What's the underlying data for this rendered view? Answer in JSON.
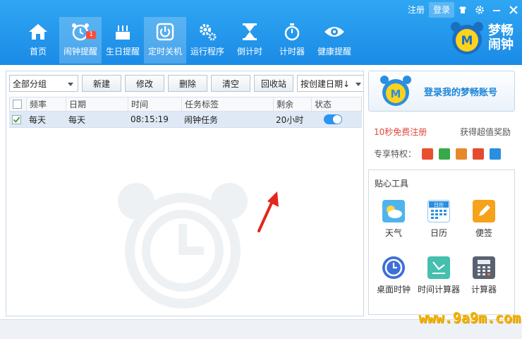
{
  "header": {
    "register": "注册",
    "login": "登录",
    "nav": [
      {
        "label": "首页",
        "icon": "home-icon"
      },
      {
        "label": "闹钟提醒",
        "icon": "alarm-clock-icon",
        "badge": "1"
      },
      {
        "label": "生日提醒",
        "icon": "birthday-cake-icon"
      },
      {
        "label": "定时关机",
        "icon": "power-icon"
      },
      {
        "label": "运行程序",
        "icon": "gear-icon"
      },
      {
        "label": "倒计时",
        "icon": "hourglass-icon"
      },
      {
        "label": "计时器",
        "icon": "stopwatch-icon"
      },
      {
        "label": "健康提醒",
        "icon": "eye-icon"
      }
    ],
    "brand": {
      "line1": "梦畅",
      "line2": "闹钟"
    }
  },
  "toolbar": {
    "group_select": "全部分组",
    "new": "新建",
    "edit": "修改",
    "delete": "删除",
    "clear": "清空",
    "recycle": "回收站",
    "sort_select": "按创建日期↓"
  },
  "table": {
    "columns": [
      "频率",
      "日期",
      "时间",
      "任务标签",
      "剩余",
      "状态"
    ],
    "rows": [
      {
        "checked": true,
        "frequency": "每天",
        "date": "每天",
        "time": "08:15:19",
        "label": "闹钟任务",
        "remaining": "20小时",
        "enabled": true
      }
    ]
  },
  "account": {
    "login_button": "登录我的梦畅账号",
    "free_register": "10秒免费注册",
    "super_reward": "获得超值奖励",
    "privileges_label": "专享特权："
  },
  "tools": {
    "title": "贴心工具",
    "calendar_icon_text": "日历",
    "items": [
      {
        "label": "天气",
        "icon": "weather-icon"
      },
      {
        "label": "日历",
        "icon": "calendar-icon"
      },
      {
        "label": "便签",
        "icon": "sticky-note-icon"
      },
      {
        "label": "桌面时钟",
        "icon": "desktop-clock-icon"
      },
      {
        "label": "时间计算器",
        "icon": "time-calculator-icon"
      },
      {
        "label": "计算器",
        "icon": "calculator-icon"
      }
    ]
  },
  "watermark": "www.9a9m.com",
  "colors": {
    "header": "#1f95ea",
    "accent": "#1a84d8",
    "red": "#e0473b",
    "toggle": "#2b95f0"
  }
}
